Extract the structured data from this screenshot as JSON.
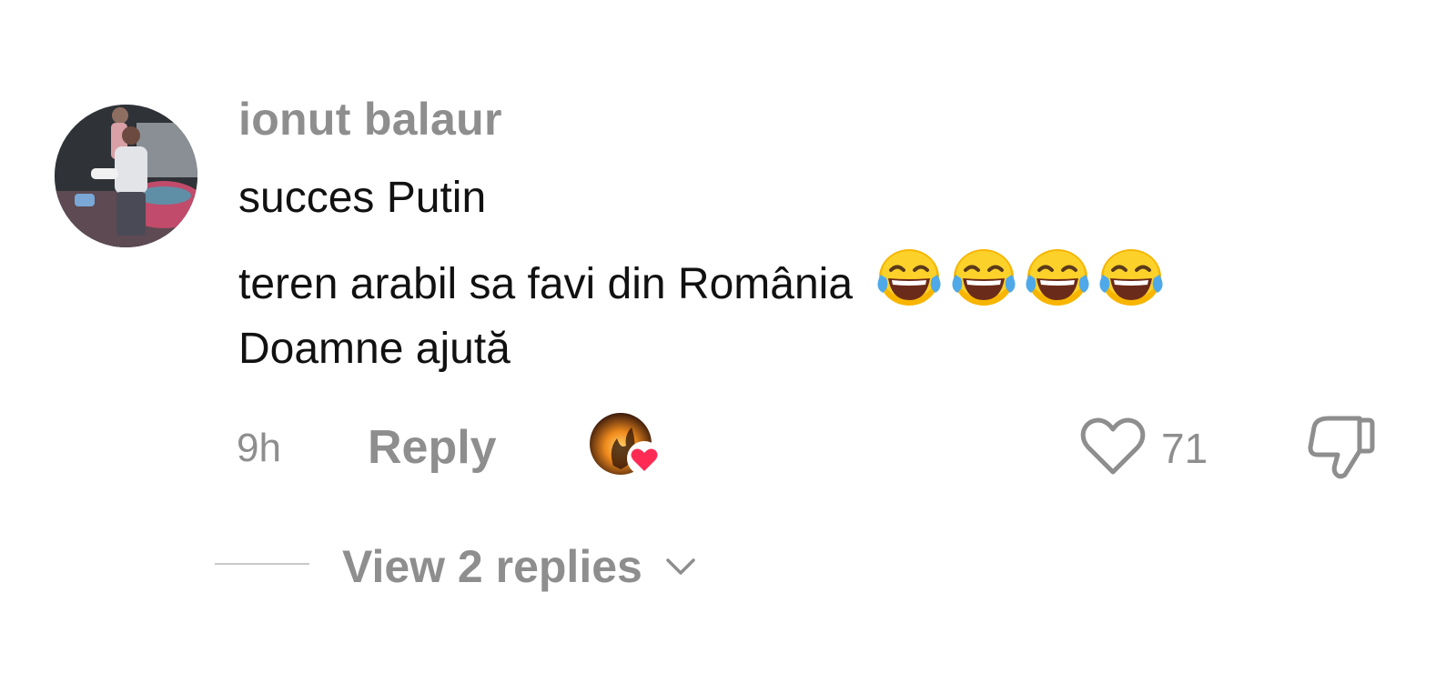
{
  "comment": {
    "username": "ionut balaur",
    "lines": [
      "succes Putin",
      "teren arabil sa favi din România",
      "Doamne ajută"
    ],
    "emojis": [
      "face-with-tears-of-joy",
      "face-with-tears-of-joy",
      "face-with-tears-of-joy",
      "face-with-tears-of-joy"
    ],
    "time": "9h",
    "reply_label": "Reply",
    "like_count": "71",
    "view_replies_label": "View 2 replies"
  },
  "icons": {
    "avatar": "user-avatar",
    "creator_liked": "creator-liked-heart-icon",
    "like": "heart-outline-icon",
    "dislike": "thumbs-down-icon",
    "expand": "chevron-down-icon"
  },
  "colors": {
    "muted_text": "#8e8e8e",
    "body_text": "#111111",
    "heart_badge": "#fe2c55"
  }
}
